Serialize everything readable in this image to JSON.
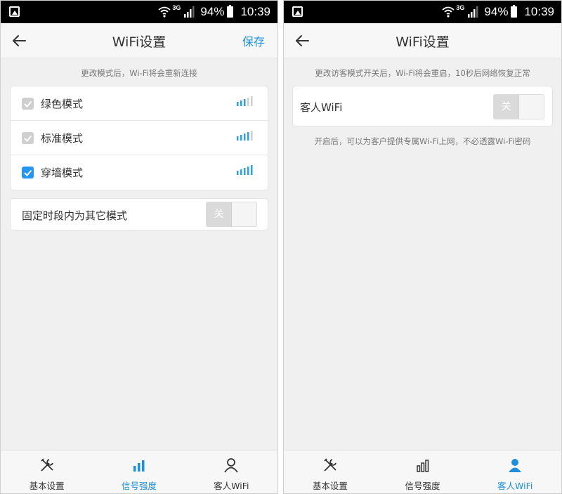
{
  "status_bar": {
    "network_type": "3G",
    "battery_percent": "94%",
    "time": "10:39"
  },
  "left_screen": {
    "header": {
      "title": "WiFi设置",
      "save_label": "保存"
    },
    "hint": "更改模式后，Wi-Fi将会重新连接",
    "modes": [
      {
        "label": "绿色模式",
        "checked": false,
        "signal_level": 3
      },
      {
        "label": "标准模式",
        "checked": false,
        "signal_level": 4
      },
      {
        "label": "穿墙模式",
        "checked": true,
        "signal_level": 5
      }
    ],
    "schedule": {
      "label": "固定时段内为其它模式",
      "toggle_text": "关",
      "enabled": false
    },
    "tabs": [
      {
        "label": "基本设置",
        "icon": "tools-icon",
        "active": false
      },
      {
        "label": "信号强度",
        "icon": "signal-bars-icon",
        "active": true
      },
      {
        "label": "客人WiFi",
        "icon": "person-icon",
        "active": false
      }
    ]
  },
  "right_screen": {
    "header": {
      "title": "WiFi设置"
    },
    "hint": "更改访客模式开关后，Wi-Fi将会重启，10秒后网络恢复正常",
    "guest_wifi": {
      "label": "客人WiFi",
      "toggle_text": "关",
      "enabled": false
    },
    "guest_hint": "开启后，可以为客户提供专属Wi-Fi上网，不必透露Wi-Fi密码",
    "tabs": [
      {
        "label": "基本设置",
        "icon": "tools-icon",
        "active": false
      },
      {
        "label": "信号强度",
        "icon": "signal-bars-icon",
        "active": false
      },
      {
        "label": "客人WiFi",
        "icon": "person-icon",
        "active": true
      }
    ]
  },
  "colors": {
    "accent": "#1e8fdd",
    "checkbox_checked": "#2196f3",
    "checkbox_unchecked": "#c8c8c8",
    "background": "#f0f0f0",
    "toggle_knob": "#dadada"
  }
}
